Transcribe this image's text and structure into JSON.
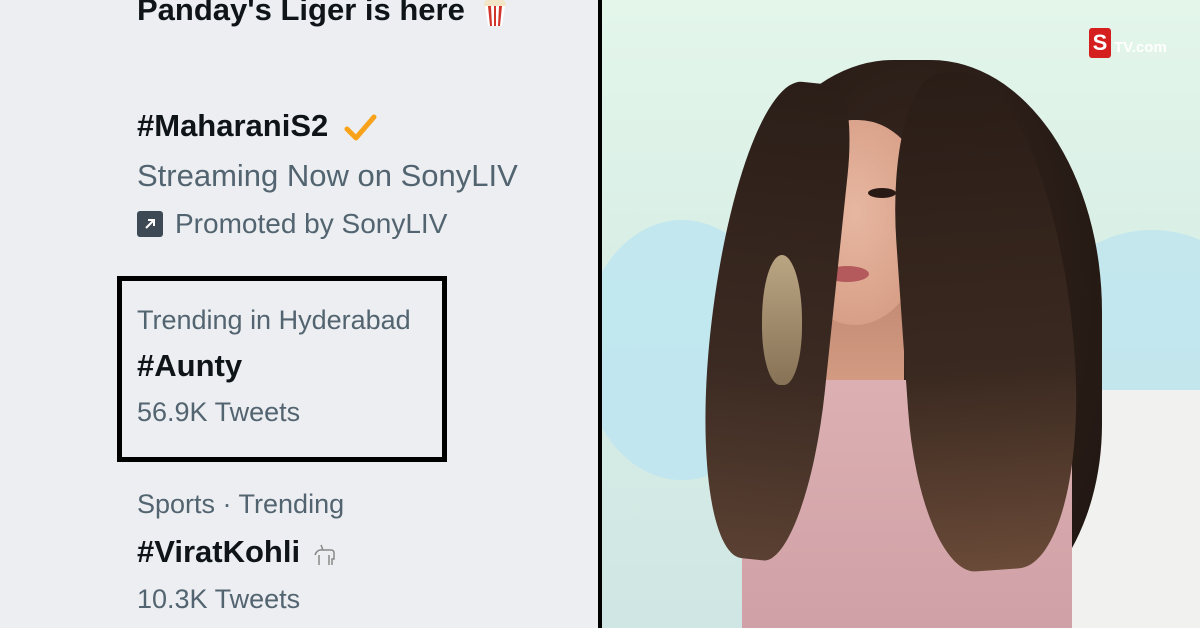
{
  "left": {
    "top_title": "Panday's Liger is here",
    "promo": {
      "hashtag": "#MaharaniS2",
      "description": "Streaming Now on SonyLIV",
      "promoted_label": "Promoted by SonyLIV"
    },
    "highlighted_trend": {
      "context": "Trending in Hyderabad",
      "hashtag": "#Aunty",
      "count": "56.9K Tweets"
    },
    "sports_trend": {
      "context": "Sports · Trending",
      "hashtag": "#ViratKohli",
      "count": "10.3K Tweets"
    }
  },
  "right": {
    "logo_mark": "S",
    "logo_text": "TV.com"
  },
  "colors": {
    "panel_bg": "#eceef1",
    "text_primary": "#0f1419",
    "text_secondary": "#536471",
    "check_orange": "#f7a21a",
    "logo_red": "#d51e1e"
  }
}
